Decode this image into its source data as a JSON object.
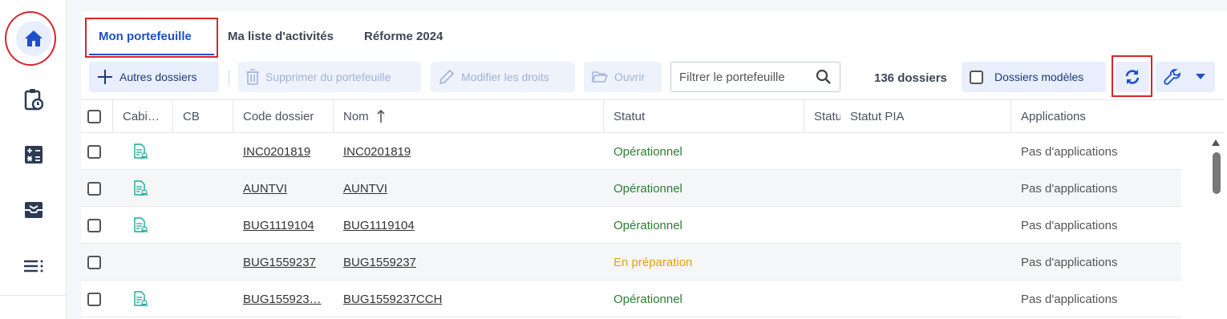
{
  "tabs": [
    {
      "label": "Mon portefeuille"
    },
    {
      "label": "Ma liste d'activités"
    },
    {
      "label": "Réforme 2024"
    }
  ],
  "toolbar": {
    "add_label": "Autres dossiers",
    "delete_label": "Supprimer du portefeuille",
    "rights_label": "Modifier les droits",
    "open_label": "Ouvrir",
    "search_placeholder": "Filtrer le portefeuille",
    "count_label": "136 dossiers",
    "models_label": "Dossiers modèles"
  },
  "columns": {
    "cabinet": "Cabi…",
    "cb": "CB",
    "code": "Code dossier",
    "nom": "Nom",
    "statut": "Statut",
    "statut_short": "Statu",
    "statut_pia": "Statut PIA",
    "applications": "Applications"
  },
  "rows": [
    {
      "code": "INC0201819",
      "nom": "INC0201819",
      "statut": "Opérationnel",
      "status_kind": "op",
      "applications": "Pas d'applications",
      "has_icon": true
    },
    {
      "code": "AUNTVI",
      "nom": "AUNTVI",
      "statut": "Opérationnel",
      "status_kind": "op",
      "applications": "Pas d'applications",
      "has_icon": true
    },
    {
      "code": "BUG1119104",
      "nom": "BUG1119104",
      "statut": "Opérationnel",
      "status_kind": "op",
      "applications": "Pas d'applications",
      "has_icon": true
    },
    {
      "code": "BUG1559237",
      "nom": "BUG1559237",
      "statut": "En préparation",
      "status_kind": "prep",
      "applications": "Pas d'applications",
      "has_icon": false
    },
    {
      "code": "BUG155923…",
      "nom": "BUG1559237CCH",
      "statut": "Opérationnel",
      "status_kind": "op",
      "applications": "Pas d'applications",
      "has_icon": true
    }
  ],
  "colors": {
    "accent": "#1d4fc9",
    "status_operational": "#2e7d32",
    "status_preparation": "#e8a10c",
    "highlight": "#d6262b"
  }
}
